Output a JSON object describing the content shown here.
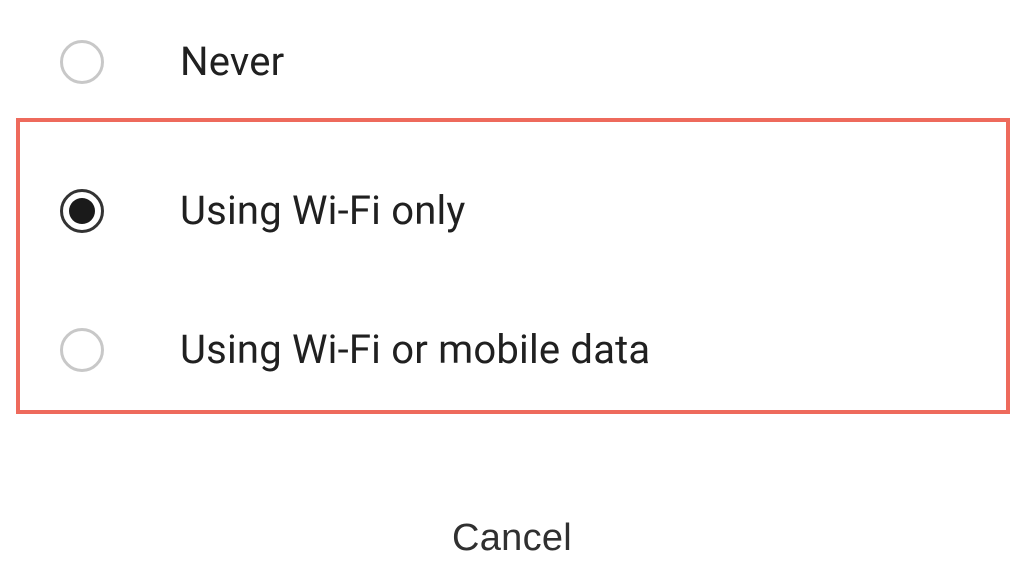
{
  "options": [
    {
      "label": "Never",
      "selected": false
    },
    {
      "label": "Using Wi-Fi only",
      "selected": true
    },
    {
      "label": "Using Wi-Fi or mobile data",
      "selected": false
    }
  ],
  "cancel_label": "Cancel",
  "highlight_color": "#ee6a5c"
}
